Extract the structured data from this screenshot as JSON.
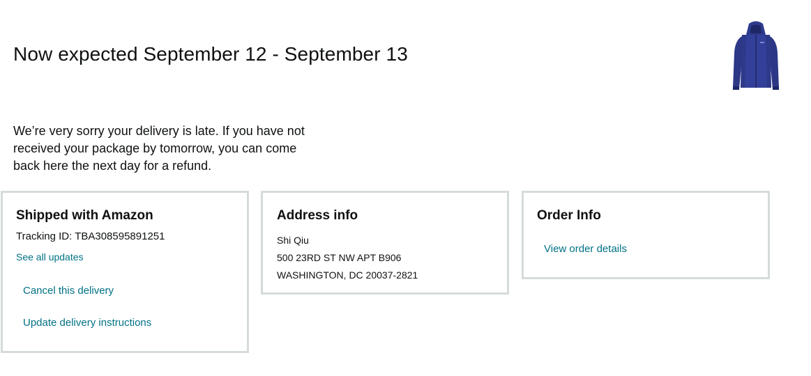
{
  "header": {
    "delivery_status": "Now expected September 12 - September 13",
    "product_image_icon": "blue-jacket-icon",
    "product_color": "#2E3A8C"
  },
  "apology_message": "We’re very sorry your delivery is late. If you have not received your package by tomorrow, you can come back here the next day for a refund.",
  "shipping_card": {
    "title": "Shipped with Amazon",
    "tracking_label": "Tracking ID: TBA308595891251",
    "see_updates": "See all updates",
    "cancel_delivery": "Cancel this delivery",
    "update_instructions": "Update delivery instructions"
  },
  "address_card": {
    "title": "Address info",
    "name": "Shi Qiu",
    "street": "500 23RD ST NW APT B906",
    "city_line": "WASHINGTON, DC 20037-2821"
  },
  "order_card": {
    "title": "Order Info",
    "view_details": "View order details"
  },
  "colors": {
    "link": "#007185",
    "card_border": "#D5DBDB",
    "text": "#0F1111"
  }
}
